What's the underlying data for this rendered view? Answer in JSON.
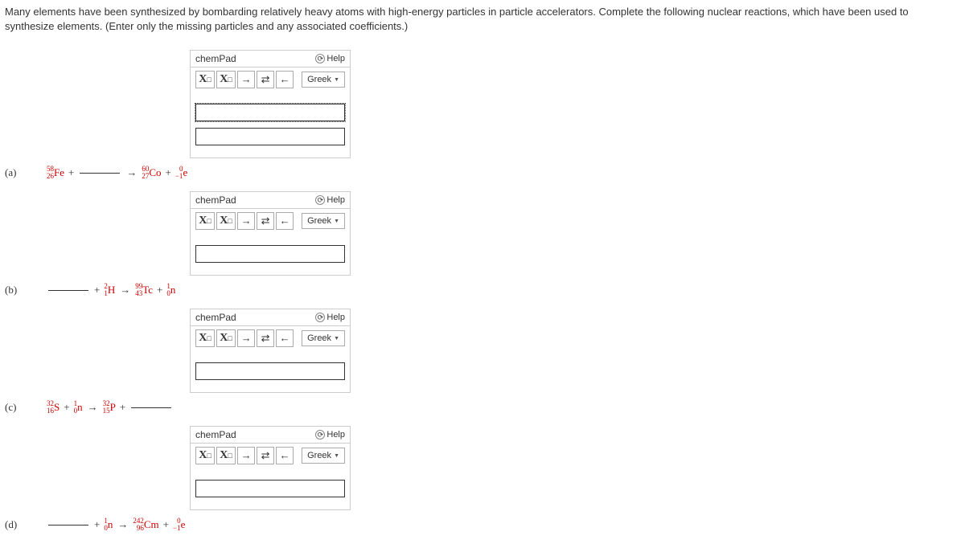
{
  "instructions": "Many elements have been synthesized by bombarding relatively heavy atoms with high-energy particles in particle accelerators. Complete the following nuclear reactions, which have been used to synthesize elements. (Enter only the missing particles and any associated coefficients.)",
  "chempad": {
    "title_prefix": "chem",
    "title_suffix": "Pad",
    "help_label": "Help",
    "greek_label": "Greek",
    "toolbar": {
      "xsub": "X",
      "xsub_sub": "□",
      "xsup": "X",
      "xsup_sup": "□",
      "arrow_right": "→",
      "arrow_equilib": "⇄",
      "arrow_left": "←"
    }
  },
  "problems": {
    "a": {
      "label": "(a)",
      "parts": {
        "fe_top": "58",
        "fe_bot": "26",
        "fe_sym": "Fe",
        "co_top": "60",
        "co_bot": "27",
        "co_sym": "Co",
        "e_top": "0",
        "e_bot": "−1",
        "e_sym": "e"
      }
    },
    "b": {
      "label": "(b)",
      "parts": {
        "h_top": "2",
        "h_bot": "1",
        "h_sym": "H",
        "tc_top": "99",
        "tc_bot": "43",
        "tc_sym": "Tc",
        "n_top": "1",
        "n_bot": "0",
        "n_sym": "n"
      }
    },
    "c": {
      "label": "(c)",
      "parts": {
        "s_top": "32",
        "s_bot": "16",
        "s_sym": "S",
        "n_top": "1",
        "n_bot": "0",
        "n_sym": "n",
        "p_top": "32",
        "p_bot": "15",
        "p_sym": "P"
      }
    },
    "d": {
      "label": "(d)",
      "parts": {
        "n_top": "1",
        "n_bot": "0",
        "n_sym": "n",
        "cm_top": "242",
        "cm_bot": "96",
        "cm_sym": "Cm",
        "e_top": "0",
        "e_bot": "−1",
        "e_sym": "e"
      }
    }
  }
}
